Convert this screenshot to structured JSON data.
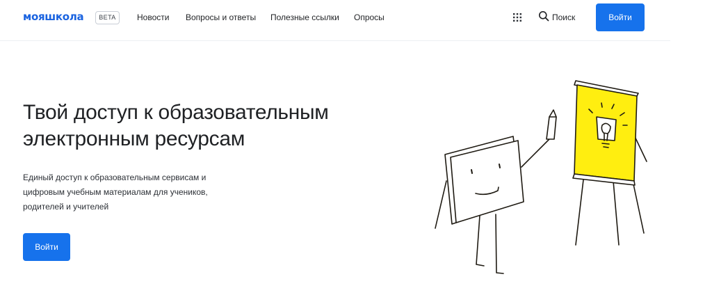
{
  "header": {
    "logo": "мояшкола",
    "badge": "BETA",
    "nav": [
      "Новости",
      "Вопросы и ответы",
      "Полезные ссылки",
      "Опросы"
    ],
    "apps_icon": "grid-icon",
    "search_icon": "search-icon",
    "search_label": "Поиск",
    "login_label": "Войти"
  },
  "hero": {
    "title": "Твой доступ к образовательным электронным ресурсам",
    "description": "Единый доступ к образовательным сервисам и цифровым учебным материалам для учеников, родителей и учителей",
    "login_label": "Войти"
  },
  "colors": {
    "brand": "#1a63e0",
    "button": "#1672ec",
    "flipchart": "#ffee10"
  }
}
